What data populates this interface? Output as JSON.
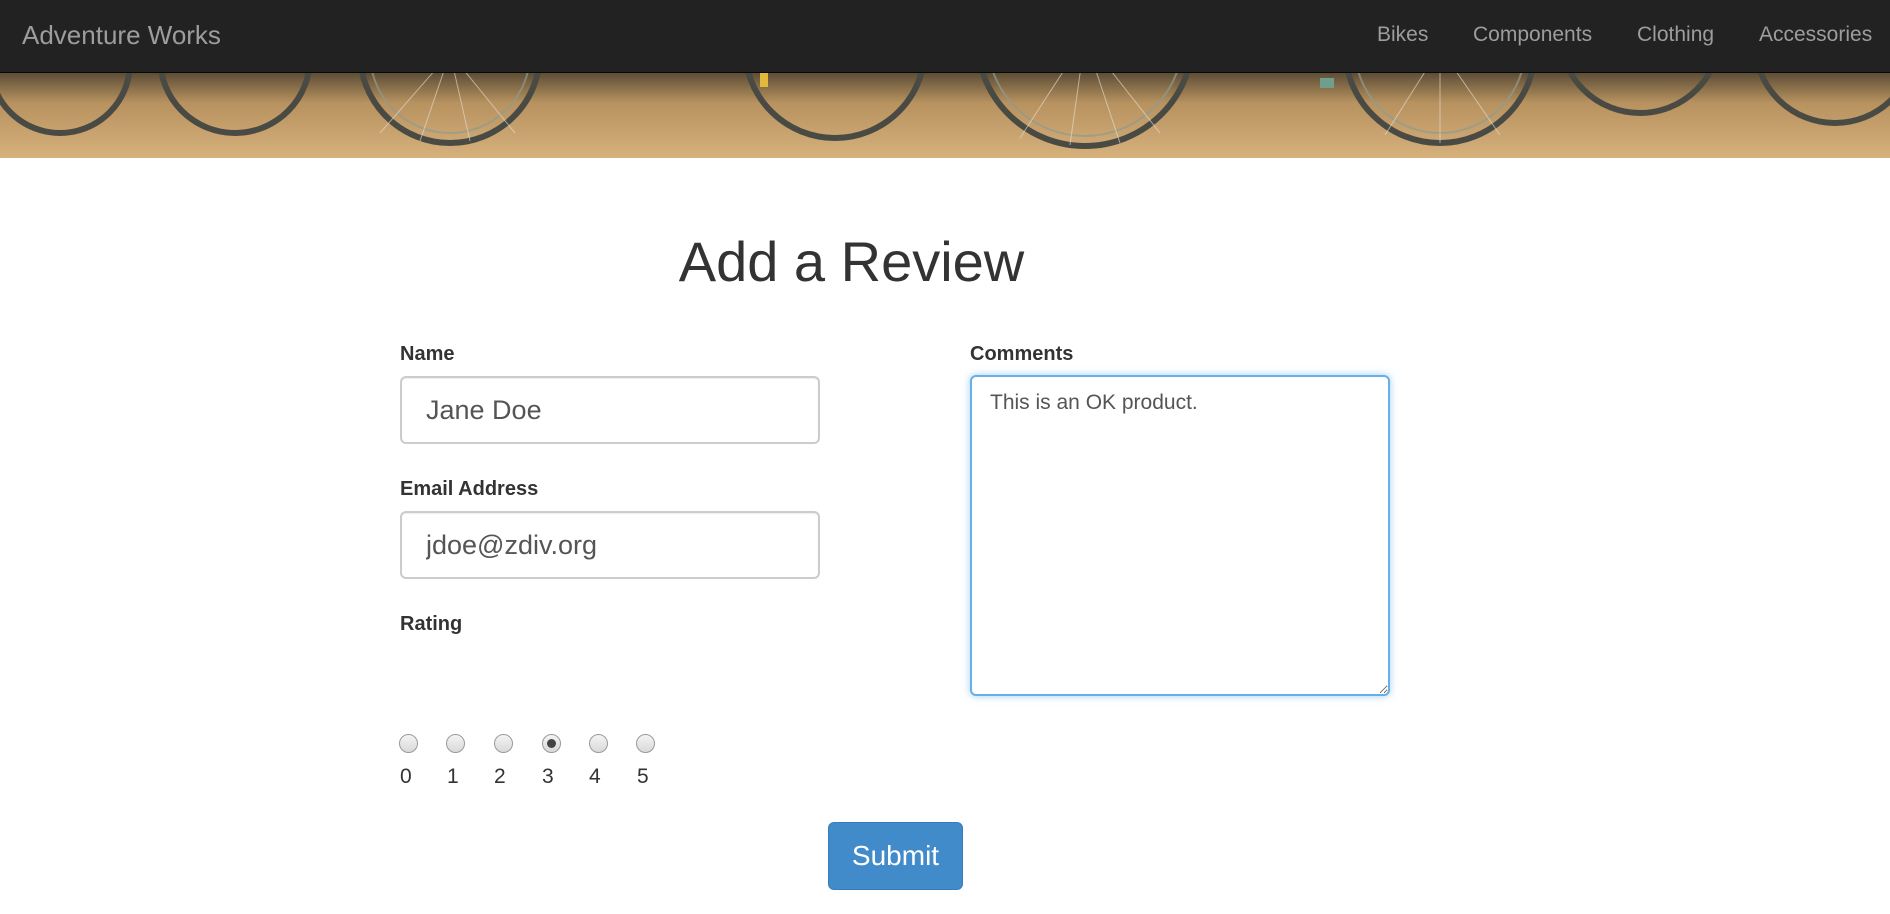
{
  "navbar": {
    "brand": "Adventure Works",
    "links": [
      "Bikes",
      "Components",
      "Clothing",
      "Accessories"
    ]
  },
  "page": {
    "title": "Add a Review"
  },
  "form": {
    "name_label": "Name",
    "name_value": "Jane Doe",
    "email_label": "Email Address",
    "email_value": "jdoe@zdiv.org",
    "rating_label": "Rating",
    "rating_options": [
      "0",
      "1",
      "2",
      "3",
      "4",
      "5"
    ],
    "rating_selected": "3",
    "comments_label": "Comments",
    "comments_value": "This is an OK product.",
    "submit_label": "Submit"
  },
  "colors": {
    "navbar_bg": "#222222",
    "nav_text": "#9d9d9d",
    "primary": "#428bca",
    "focus_border": "#66afe9"
  }
}
